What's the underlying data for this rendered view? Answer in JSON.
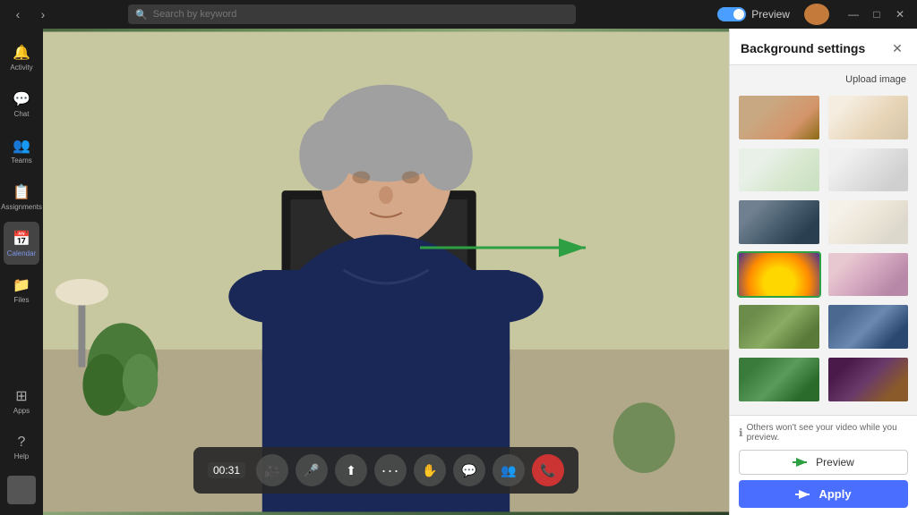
{
  "titlebar": {
    "nav_back": "‹",
    "nav_forward": "›",
    "search_placeholder": "Search by keyword",
    "preview_label": "Preview",
    "window_controls": {
      "minimize": "—",
      "maximize": "□",
      "close": "✕"
    }
  },
  "sidebar": {
    "items": [
      {
        "id": "activity",
        "label": "Activity",
        "icon": "🔔"
      },
      {
        "id": "chat",
        "label": "Chat",
        "icon": "💬"
      },
      {
        "id": "teams",
        "label": "Teams",
        "icon": "👥"
      },
      {
        "id": "assignments",
        "label": "Assignments",
        "icon": "📋"
      },
      {
        "id": "calendar",
        "label": "Calendar",
        "icon": "📅"
      },
      {
        "id": "files",
        "label": "Files",
        "icon": "📁"
      },
      {
        "id": "apps",
        "label": "Apps",
        "icon": "⊞"
      },
      {
        "id": "help",
        "label": "Help",
        "icon": "?"
      }
    ]
  },
  "call": {
    "timer": "00:31",
    "controls": [
      {
        "id": "video",
        "icon": "🎥",
        "label": "Video"
      },
      {
        "id": "mic",
        "icon": "🎤",
        "label": "Microphone"
      },
      {
        "id": "share",
        "icon": "⬆",
        "label": "Share screen"
      },
      {
        "id": "more",
        "icon": "•••",
        "label": "More"
      },
      {
        "id": "raise",
        "icon": "✋",
        "label": "Raise hand"
      },
      {
        "id": "chat-ctrl",
        "icon": "💬",
        "label": "Chat"
      },
      {
        "id": "participants",
        "icon": "👥",
        "label": "Participants"
      },
      {
        "id": "end",
        "icon": "📞",
        "label": "End call"
      }
    ]
  },
  "bg_panel": {
    "title": "Background settings",
    "close_label": "✕",
    "upload_label": "Upload image",
    "thumbnails": [
      {
        "id": 0,
        "class": "thumb-0",
        "alt": "Office room with orange couch",
        "selected": false
      },
      {
        "id": 1,
        "class": "thumb-1",
        "alt": "Bright white room",
        "selected": false
      },
      {
        "id": 2,
        "class": "thumb-2",
        "alt": "Open floor plan office",
        "selected": false
      },
      {
        "id": 3,
        "class": "thumb-3",
        "alt": "Minimalist white room",
        "selected": false
      },
      {
        "id": 4,
        "class": "thumb-4",
        "alt": "Modern office building",
        "selected": false
      },
      {
        "id": 5,
        "class": "thumb-5",
        "alt": "Bright interior room",
        "selected": false
      },
      {
        "id": 6,
        "class": "thumb-6-sel",
        "alt": "Yellow umbrella abstract",
        "selected": true
      },
      {
        "id": 7,
        "class": "thumb-7",
        "alt": "Pink clouds landscape",
        "selected": false
      },
      {
        "id": 8,
        "class": "thumb-8",
        "alt": "Colorful garden room",
        "selected": false
      },
      {
        "id": 9,
        "class": "thumb-9",
        "alt": "Blue office background",
        "selected": false
      },
      {
        "id": 10,
        "class": "thumb-10",
        "alt": "Minecraft green scene",
        "selected": false
      },
      {
        "id": 11,
        "class": "thumb-11",
        "alt": "Minecraft dark scene",
        "selected": false
      }
    ],
    "footer_note": "Others won't see your video while you preview.",
    "preview_btn_label": "Preview",
    "apply_btn_label": "Apply"
  },
  "arrow": {
    "color": "#2ea043"
  }
}
